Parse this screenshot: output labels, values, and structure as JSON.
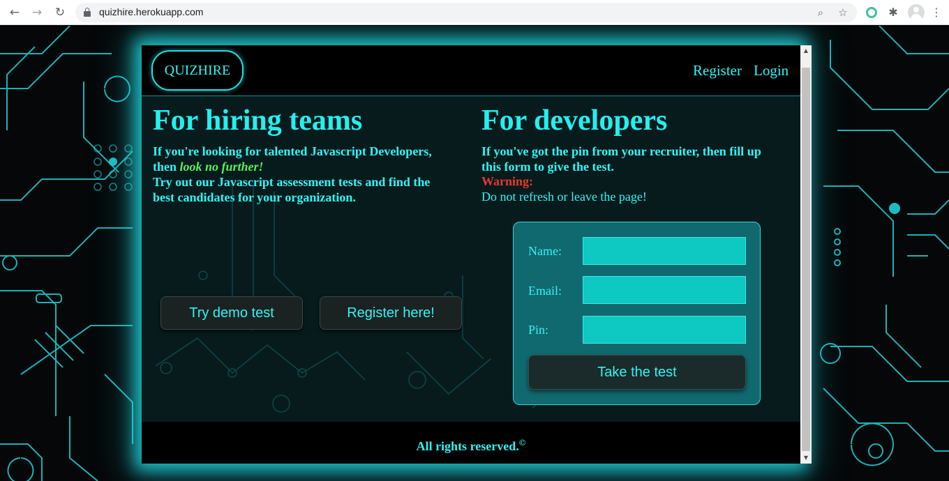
{
  "browser": {
    "url": "quizhire.herokuapp.com",
    "icons": [
      "back-arrow-icon",
      "forward-arrow-icon",
      "reload-icon",
      "lock-icon",
      "zoom-icon",
      "star-icon",
      "extension-icon",
      "puzzle-icon",
      "profile-icon",
      "menu-icon"
    ]
  },
  "header": {
    "logo": "QUIZHIRE",
    "nav": [
      "Register",
      "Login"
    ]
  },
  "hiring": {
    "title": "For hiring teams",
    "line1": "If you're looking for talented Javascript Developers,",
    "line2_prefix": "then ",
    "line2_emph": "look no further!",
    "line3": "Try out our Javascript assessment tests and find the",
    "line4": "best candidates for your organization.",
    "buttons": [
      "Try demo test",
      "Register here!"
    ]
  },
  "developers": {
    "title": "For developers",
    "line1": "If you've got the pin from your recruiter, then fill up",
    "line2": "this form to give the test.",
    "warning": "Warning:",
    "note": "Do not refresh or leave the page!",
    "form": {
      "labels": [
        "Name:",
        "Email:",
        "Pin:"
      ],
      "values": [
        "",
        "",
        ""
      ],
      "submit": "Take the test"
    }
  },
  "footer": {
    "text": "All rights reserved.",
    "symbol": "©"
  },
  "colors": {
    "accent": "#22f0f0",
    "emphasis": "#55f05a",
    "warning": "#e53a2c",
    "form_bg": "#10696e",
    "input_bg": "#0ec8c2"
  }
}
